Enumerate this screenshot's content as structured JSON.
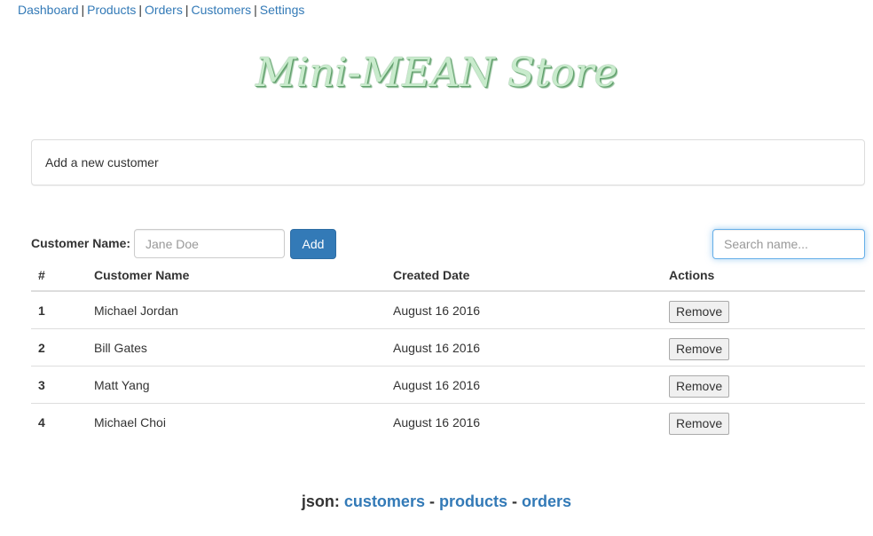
{
  "nav": {
    "items": [
      "Dashboard",
      "Products",
      "Orders",
      "Customers",
      "Settings"
    ],
    "separator": "|"
  },
  "title": "Mini-MEAN Store",
  "add_panel": {
    "label": "Add a new customer"
  },
  "form": {
    "label": "Customer Name:",
    "name_placeholder": "Jane Doe",
    "add_label": "Add",
    "search_placeholder": "Search name..."
  },
  "table": {
    "headers": [
      "#",
      "Customer Name",
      "Created Date",
      "Actions"
    ],
    "rows": [
      {
        "num": "1",
        "name": "Michael Jordan",
        "date": "August 16 2016",
        "action": "Remove"
      },
      {
        "num": "2",
        "name": "Bill Gates",
        "date": "August 16 2016",
        "action": "Remove"
      },
      {
        "num": "3",
        "name": "Matt Yang",
        "date": "August 16 2016",
        "action": "Remove"
      },
      {
        "num": "4",
        "name": "Michael Choi",
        "date": "August 16 2016",
        "action": "Remove"
      }
    ]
  },
  "footer": {
    "prefix": "json:",
    "links": [
      "customers",
      "products",
      "orders"
    ],
    "separator": "-"
  },
  "colors": {
    "link": "#337ab7",
    "primary_button": "#337ab7",
    "title_fill": "#c8ebcc",
    "border": "#dddddd"
  }
}
